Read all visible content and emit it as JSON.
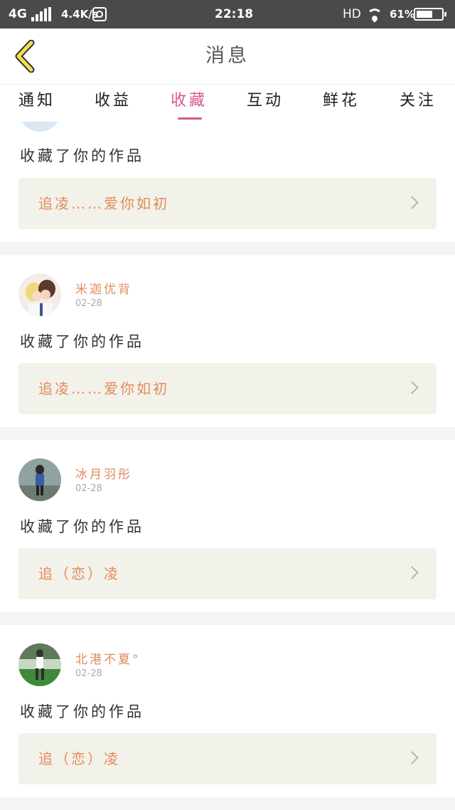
{
  "status_bar": {
    "network": "4G",
    "speed": "4.4K/s",
    "time": "22:18",
    "hd": "HD",
    "battery": "61%"
  },
  "header": {
    "title": "消息"
  },
  "tabs": [
    {
      "label": "通知"
    },
    {
      "label": "收益"
    },
    {
      "label": "收藏",
      "active": true
    },
    {
      "label": "互动"
    },
    {
      "label": "鲜花"
    },
    {
      "label": "关注"
    }
  ],
  "messages": [
    {
      "action": "收藏了你的作品",
      "work": "追凌……爱你如初"
    },
    {
      "user": "米迦优背",
      "date": "02-28",
      "action": "收藏了你的作品",
      "work": "追凌……爱你如初"
    },
    {
      "user": "冰月羽彤",
      "date": "02-28",
      "action": "收藏了你的作品",
      "work": "追（恋）凌"
    },
    {
      "user": "北港不夏°",
      "date": "02-28",
      "action": "收藏了你的作品",
      "work": "追（恋）凌"
    }
  ],
  "colors": {
    "accent": "#d9578f",
    "name": "#e28a5c",
    "status_bar": "#4a4a4a"
  }
}
